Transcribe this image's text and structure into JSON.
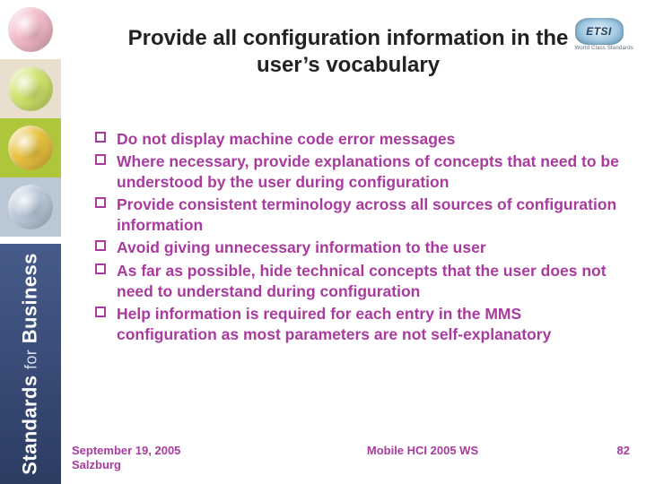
{
  "logo": {
    "text": "ETSI",
    "subtitle": "World Class Standards"
  },
  "sidebar_label": {
    "bold1": "Standards",
    "thin": "for",
    "bold2": "Business"
  },
  "title": "Provide all configuration information in the user’s vocabulary",
  "bullets": [
    "Do not display machine code error messages",
    "Where necessary, provide explanations of concepts that need to be understood by the user during configuration",
    "Provide consistent terminology across all sources of configuration information",
    "Avoid giving unnecessary information to the user",
    "As far as possible, hide technical concepts that the user does not need to understand during configuration",
    "Help information is required for each entry in the MMS configuration as most parameters are not self-explanatory"
  ],
  "footer": {
    "date_line1": "September 19, 2005",
    "date_line2": "Salzburg",
    "event": "Mobile HCI 2005 WS",
    "page": "82"
  }
}
